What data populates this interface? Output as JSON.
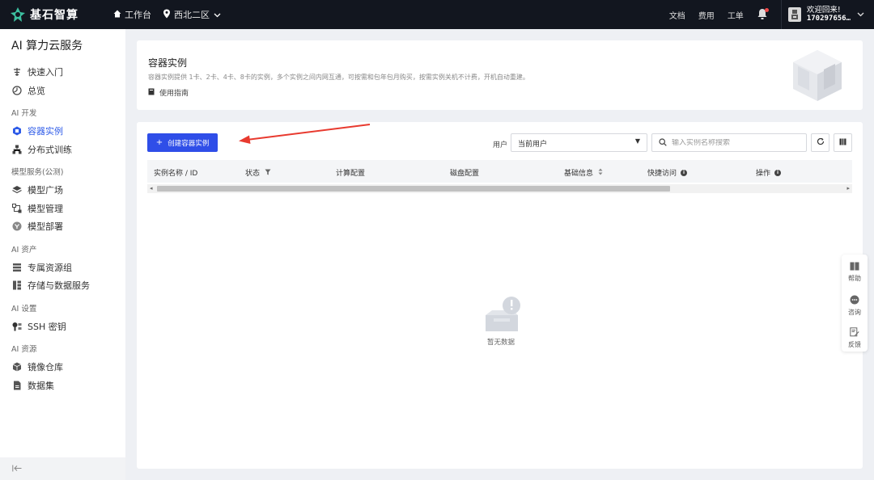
{
  "topbar": {
    "logo_text": "基石智算",
    "nav": [
      {
        "label": "工作台",
        "icon": "home-icon"
      },
      {
        "label": "西北二区",
        "icon": "location-pin-icon"
      }
    ],
    "links": [
      "文档",
      "费用",
      "工单"
    ],
    "user": {
      "greeting": "欢迎回来!",
      "id": "170297656…"
    }
  },
  "sidebar": {
    "title": "AI 算力云服务",
    "groups": [
      {
        "label": "",
        "items": [
          {
            "label": "快速入门",
            "icon": "rocket-icon"
          },
          {
            "label": "总览",
            "icon": "dashboard-icon"
          }
        ]
      },
      {
        "label": "AI 开发",
        "items": [
          {
            "label": "容器实例",
            "icon": "container-icon",
            "active": true
          },
          {
            "label": "分布式训练",
            "icon": "distributed-icon"
          }
        ]
      },
      {
        "label": "模型服务(公测)",
        "items": [
          {
            "label": "模型广场",
            "icon": "layers-icon"
          },
          {
            "label": "模型管理",
            "icon": "model-manage-icon"
          },
          {
            "label": "模型部署",
            "icon": "deploy-icon"
          }
        ]
      },
      {
        "label": "AI 资产",
        "items": [
          {
            "label": "专属资源组",
            "icon": "server-icon"
          },
          {
            "label": "存储与数据服务",
            "icon": "storage-icon"
          }
        ]
      },
      {
        "label": "AI 设置",
        "items": [
          {
            "label": "SSH 密钥",
            "icon": "key-icon"
          }
        ]
      },
      {
        "label": "AI 资源",
        "items": [
          {
            "label": "镜像仓库",
            "icon": "cube-icon"
          },
          {
            "label": "数据集",
            "icon": "dataset-icon"
          }
        ]
      }
    ]
  },
  "header_panel": {
    "title": "容器实例",
    "description": "容器实例提供 1卡、2卡、4卡、8卡的实例，多个实例之间内网互通，可按需和包年包月购买，按需实例关机不计费，开机自动重建。",
    "guide_link": "使用指南"
  },
  "toolbar": {
    "create_label": "创建容器实例",
    "user_label": "用户",
    "user_select_value": "当前用户",
    "search_placeholder": "输入实例名称搜索"
  },
  "table": {
    "columns": [
      "实例名称 / ID",
      "状态",
      "计算配置",
      "磁盘配置",
      "基础信息",
      "快捷访问",
      "操作"
    ]
  },
  "empty_text": "暂无数据",
  "float_bar": [
    "帮助",
    "咨询",
    "反馈"
  ],
  "colors": {
    "primary": "#2f4ee8",
    "topbar": "#12161f",
    "annotation_arrow": "#e83a2f"
  }
}
